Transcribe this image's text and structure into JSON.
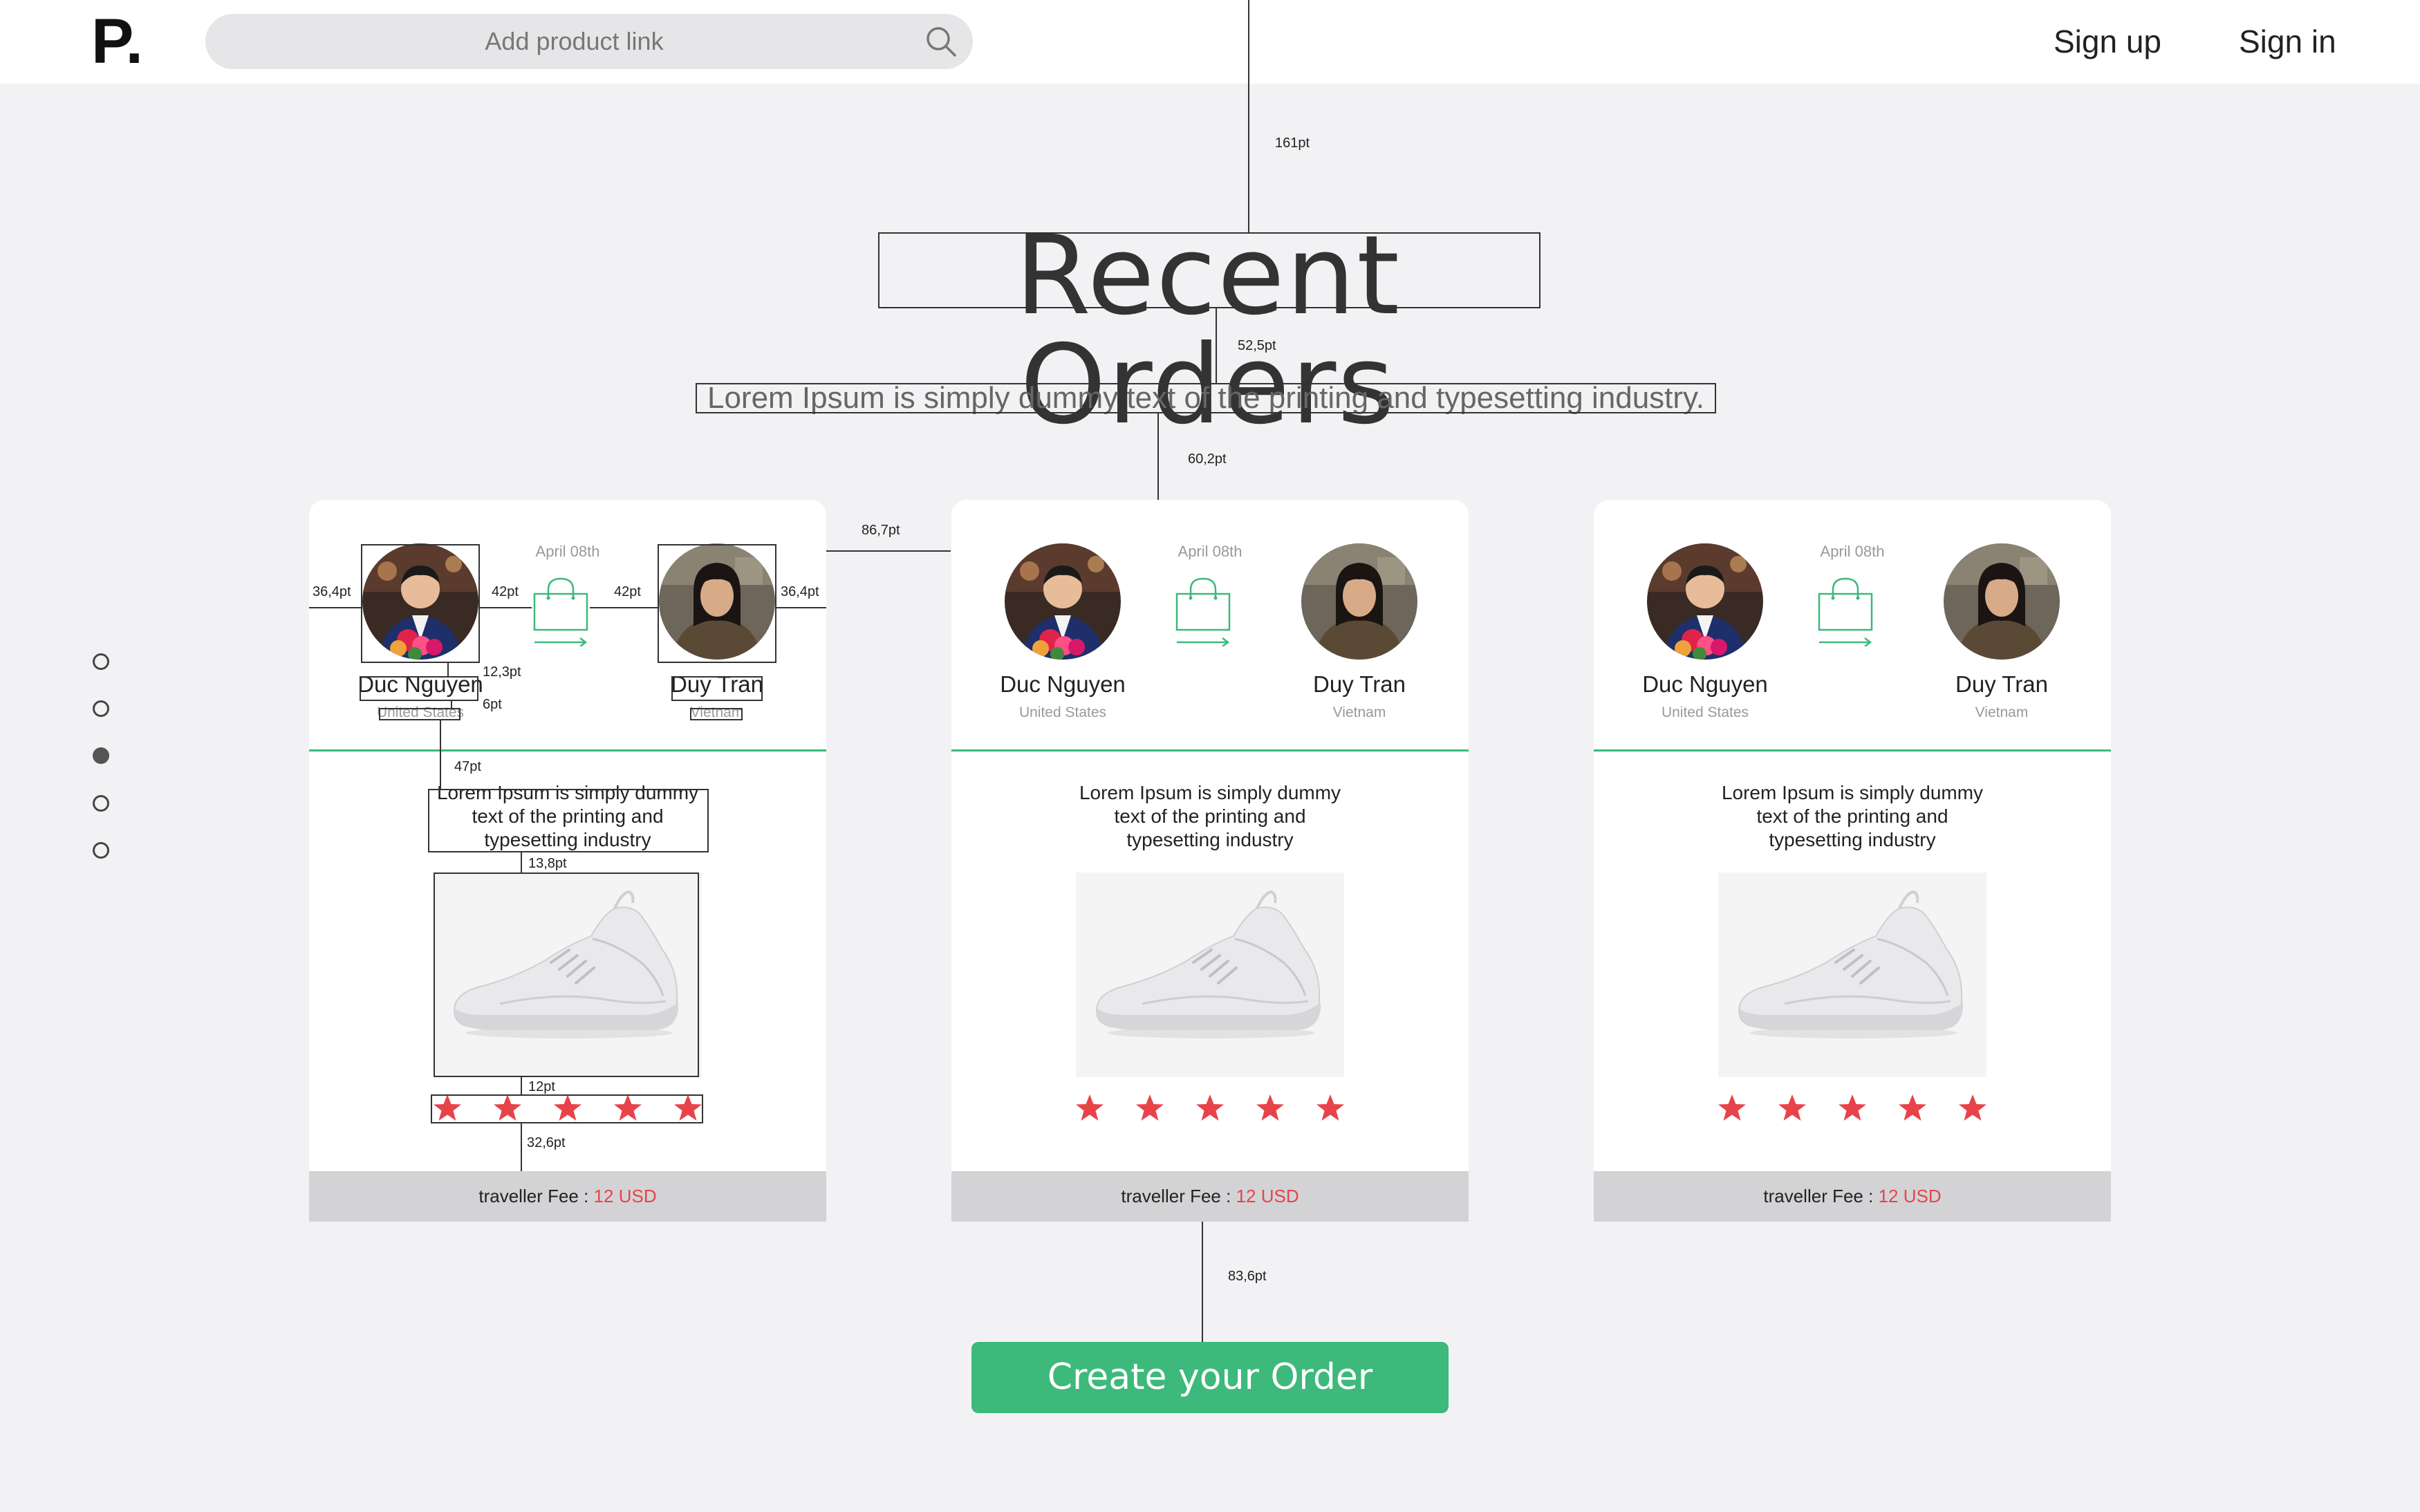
{
  "header": {
    "logo": "P.",
    "search_placeholder": "Add product link",
    "sign_up": "Sign up",
    "sign_in": "Sign in"
  },
  "hero": {
    "title": "Recent Orders",
    "subtitle": "Lorem Ipsum is simply dummy text of the printing and typesetting industry."
  },
  "measurements": {
    "m161": "161pt",
    "m52": "52,5pt",
    "m60": "60,2pt",
    "m86": "86,7pt",
    "m36a": "36,4pt",
    "m42a": "42pt",
    "m42b": "42pt",
    "m36b": "36,4pt",
    "m12_3": "12,3pt",
    "m6": "6pt",
    "m47": "47pt",
    "m13_8": "13,8pt",
    "m12": "12pt",
    "m32_6": "32,6pt",
    "m83_6": "83,6pt"
  },
  "pagination": {
    "total": 5,
    "active_index": 2
  },
  "cards": [
    {
      "date": "April 08th",
      "sender": {
        "name": "Duc Nguyen",
        "country": "United States"
      },
      "receiver": {
        "name": "Duy Tran",
        "country": "Vietnam"
      },
      "description": "Lorem Ipsum is simply dummy text of the printing and typesetting industry",
      "rating": 5,
      "fee_label": "traveller Fee :",
      "fee_amount": "12 USD"
    },
    {
      "date": "April 08th",
      "sender": {
        "name": "Duc Nguyen",
        "country": "United States"
      },
      "receiver": {
        "name": "Duy Tran",
        "country": "Vietnam"
      },
      "description": "Lorem Ipsum is simply dummy text of the printing and typesetting industry",
      "rating": 5,
      "fee_label": "traveller Fee :",
      "fee_amount": "12 USD"
    },
    {
      "date": "April 08th",
      "sender": {
        "name": "Duc Nguyen",
        "country": "United States"
      },
      "receiver": {
        "name": "Duy Tran",
        "country": "Vietnam"
      },
      "description": "Lorem Ipsum is simply dummy text of the printing and typesetting industry",
      "rating": 5,
      "fee_label": "traveller Fee :",
      "fee_amount": "12 USD"
    }
  ],
  "cta": {
    "label": "Create your Order"
  },
  "icons": {
    "search": "search-icon",
    "bag": "shopping-bag-icon",
    "star": "star-icon",
    "shoe": "sneaker-image"
  },
  "colors": {
    "accent_green": "#3cb97b",
    "star_red": "#e8434a",
    "background": "#f2f2f4",
    "fee_bar": "#d3d3d5"
  }
}
